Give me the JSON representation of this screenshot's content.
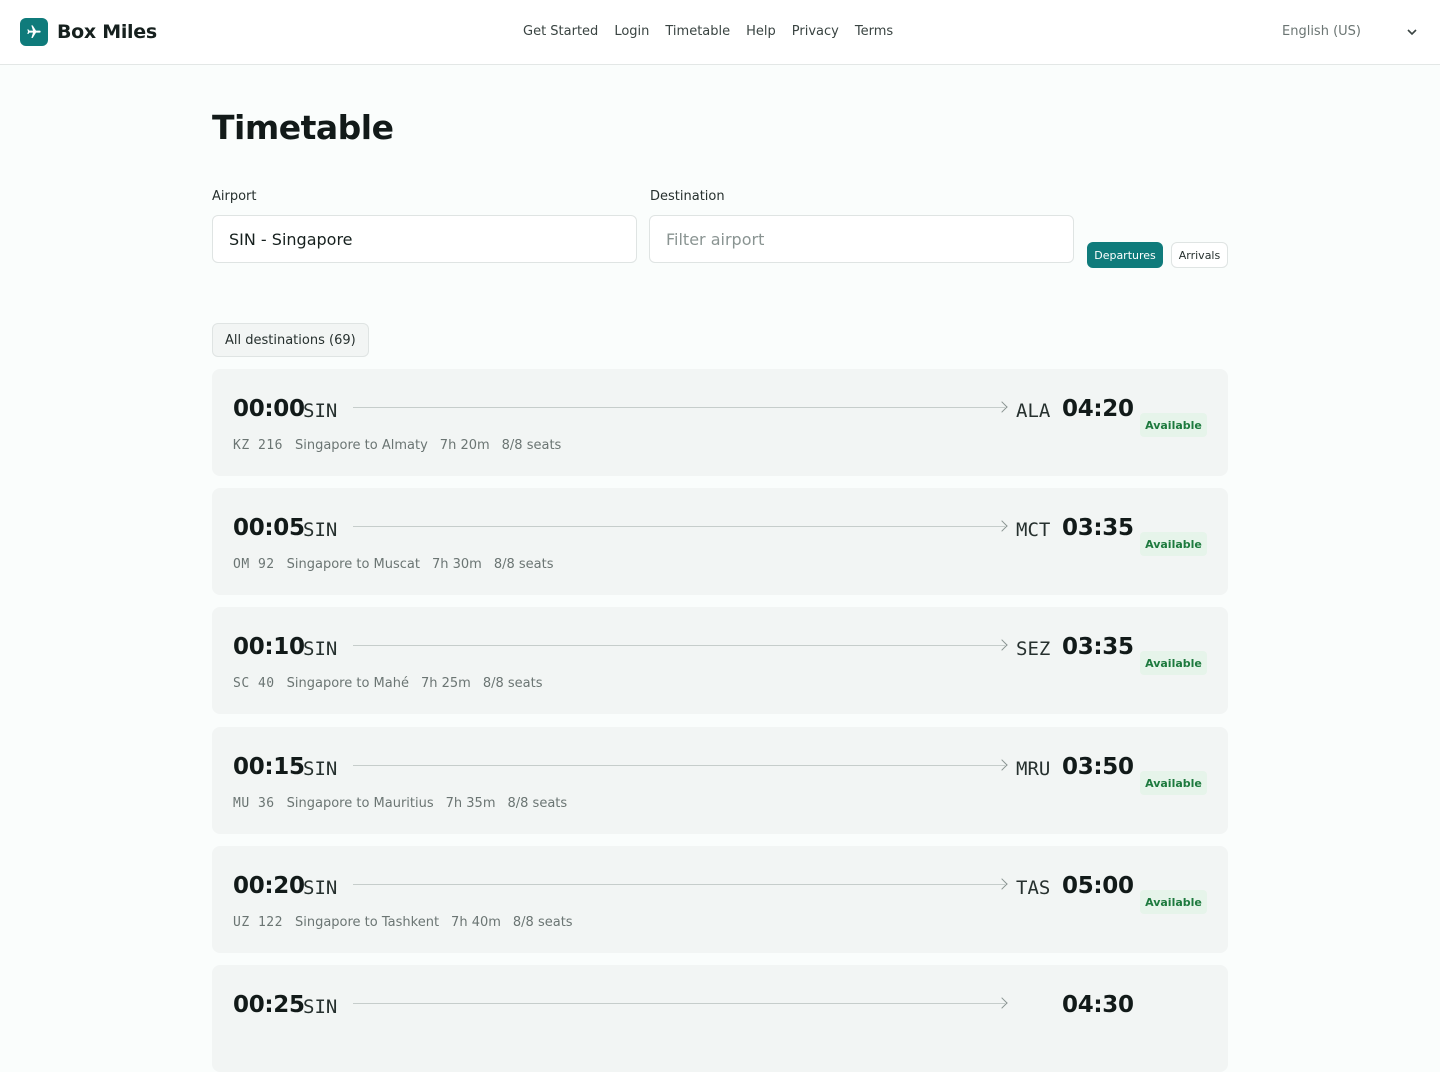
{
  "header": {
    "brand": "Box Miles",
    "nav": [
      "Get Started",
      "Login",
      "Timetable",
      "Help",
      "Privacy",
      "Terms"
    ],
    "language": "English (US)"
  },
  "page": {
    "title": "Timetable"
  },
  "filters": {
    "airport_label": "Airport",
    "airport_value": "SIN - Singapore",
    "destination_label": "Destination",
    "destination_placeholder": "Filter airport",
    "departures_label": "Departures",
    "arrivals_label": "Arrivals",
    "all_destinations_label": "All destinations (69)"
  },
  "colors": {
    "accent": "#0f7b7b",
    "available_bg": "#e6f4ea",
    "available_text": "#1d7a3e"
  },
  "flights": [
    {
      "dep_time": "00:00",
      "dep_code": "SIN",
      "arr_code": "ALA",
      "arr_time": "04:20",
      "flight_no": "KZ 216",
      "route": "Singapore to Almaty",
      "duration": "7h 20m",
      "seats": "8/8 seats",
      "status": "Available"
    },
    {
      "dep_time": "00:05",
      "dep_code": "SIN",
      "arr_code": "MCT",
      "arr_time": "03:35",
      "flight_no": "OM 92",
      "route": "Singapore to Muscat",
      "duration": "7h 30m",
      "seats": "8/8 seats",
      "status": "Available"
    },
    {
      "dep_time": "00:10",
      "dep_code": "SIN",
      "arr_code": "SEZ",
      "arr_time": "03:35",
      "flight_no": "SC 40",
      "route": "Singapore to Mahé",
      "duration": "7h 25m",
      "seats": "8/8 seats",
      "status": "Available"
    },
    {
      "dep_time": "00:15",
      "dep_code": "SIN",
      "arr_code": "MRU",
      "arr_time": "03:50",
      "flight_no": "MU 36",
      "route": "Singapore to Mauritius",
      "duration": "7h 35m",
      "seats": "8/8 seats",
      "status": "Available"
    },
    {
      "dep_time": "00:20",
      "dep_code": "SIN",
      "arr_code": "TAS",
      "arr_time": "05:00",
      "flight_no": "UZ 122",
      "route": "Singapore to Tashkent",
      "duration": "7h 40m",
      "seats": "8/8 seats",
      "status": "Available"
    },
    {
      "dep_time": "00:25",
      "dep_code": "SIN",
      "arr_code": "",
      "arr_time": "04:30",
      "flight_no": "",
      "route": "",
      "duration": "",
      "seats": "",
      "status": ""
    }
  ]
}
